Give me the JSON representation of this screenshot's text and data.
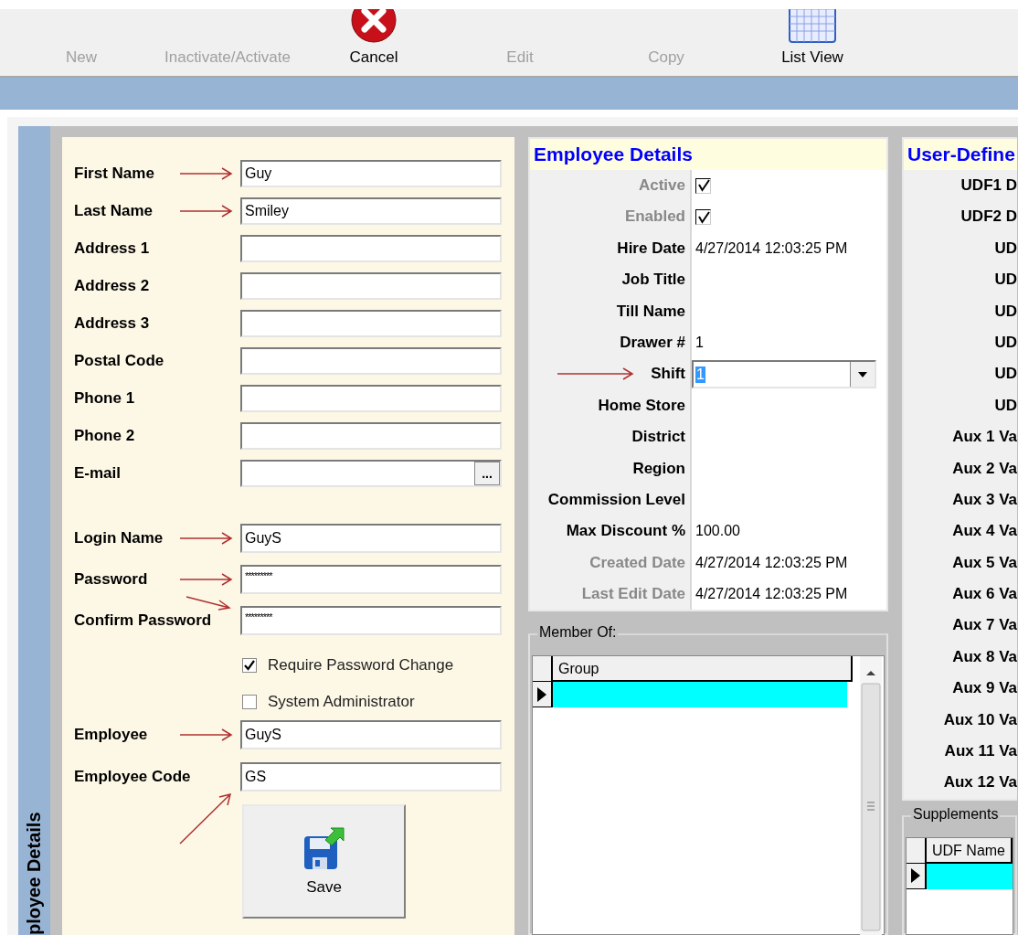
{
  "toolbar": [
    {
      "label": "New",
      "disabled": true
    },
    {
      "label": "Inactivate/Activate",
      "disabled": true
    },
    {
      "label": "Cancel",
      "disabled": false
    },
    {
      "label": "Edit",
      "disabled": true
    },
    {
      "label": "Copy",
      "disabled": true
    },
    {
      "label": "List View",
      "disabled": false
    }
  ],
  "side_tab": {
    "label": "ployee Details"
  },
  "form": {
    "contact": [
      {
        "label": "First Name",
        "value": "Guy",
        "arrow": {
          "kind": "right"
        }
      },
      {
        "label": "Last Name",
        "value": "Smiley",
        "arrow": {
          "kind": "right"
        }
      },
      {
        "label": "Address 1"
      },
      {
        "label": "Address 2"
      },
      {
        "label": "Address 3"
      },
      {
        "label": "Postal Code"
      },
      {
        "label": "Phone 1"
      },
      {
        "label": "Phone 2"
      },
      {
        "label": "E-mail",
        "button": "..."
      }
    ],
    "login": [
      {
        "label": "Login Name",
        "value": "GuyS",
        "arrow": {
          "kind": "right"
        }
      },
      {
        "label": "Password",
        "value": "*********",
        "arrow": {
          "kind": "right"
        }
      },
      {
        "label": "Confirm Password",
        "value": "*********",
        "arrow": {
          "kind": "slant"
        }
      }
    ],
    "options": [
      {
        "label": "Require Password Change",
        "checked": true
      },
      {
        "label": "System Administrator",
        "checked": false
      }
    ],
    "employee": [
      {
        "label": "Employee",
        "value": "GuyS",
        "arrow": {
          "kind": "right"
        }
      },
      {
        "label": "Employee Code",
        "value": "GS",
        "arrow": {
          "kind": "rising"
        }
      }
    ],
    "save_button": {
      "label": "Save"
    }
  },
  "details": {
    "title": "Employee Details",
    "rows": [
      {
        "label": "Active",
        "disabled": true,
        "kind": "check",
        "checked": true
      },
      {
        "label": "Enabled",
        "disabled": true,
        "kind": "check",
        "checked": true
      },
      {
        "label": "Hire Date",
        "disabled": false,
        "kind": "text",
        "value": "4/27/2014 12:03:25 PM"
      },
      {
        "label": "Job Title",
        "disabled": false,
        "kind": "text"
      },
      {
        "label": "Till Name",
        "disabled": false,
        "kind": "text"
      },
      {
        "label": "Drawer #",
        "disabled": false,
        "kind": "text",
        "value": "1"
      },
      {
        "label": "Shift",
        "disabled": false,
        "kind": "combo",
        "value": "1",
        "highlighted": true,
        "arrow": {
          "kind": "right"
        }
      },
      {
        "label": "Home Store",
        "disabled": false,
        "kind": "text"
      },
      {
        "label": "District",
        "disabled": false,
        "kind": "text"
      },
      {
        "label": "Region",
        "disabled": false,
        "kind": "text"
      },
      {
        "label": "Commission Level",
        "disabled": false,
        "kind": "text"
      },
      {
        "label": "Max Discount %",
        "disabled": false,
        "kind": "text",
        "value": "100.00"
      },
      {
        "label": "Created Date",
        "disabled": true,
        "kind": "text",
        "value": "4/27/2014 12:03:25 PM"
      },
      {
        "label": "Last Edit Date",
        "disabled": true,
        "kind": "text",
        "value": "4/27/2014 12:03:25 PM"
      }
    ]
  },
  "member_of": {
    "title": "Member Of:",
    "columns": [
      "Group"
    ],
    "rows": [
      {
        "selected": true
      }
    ]
  },
  "user_defined": {
    "title": "User-Define",
    "labels": [
      "UDF1 D",
      "UDF2 D",
      "UD",
      "UD",
      "UD",
      "UD",
      "UD",
      "UD",
      "Aux 1 Va",
      "Aux 2 Va",
      "Aux 3 Va",
      "Aux 4 Va",
      "Aux 5 Va",
      "Aux 6 Va",
      "Aux 7 Va",
      "Aux 8 Va",
      "Aux 9 Va",
      "Aux 10 Va",
      "Aux 11 Va",
      "Aux 12 Va"
    ]
  },
  "supplements": {
    "title": "Supplements",
    "columns": [
      "UDF Name"
    ],
    "rows": [
      {
        "selected": true
      }
    ]
  }
}
